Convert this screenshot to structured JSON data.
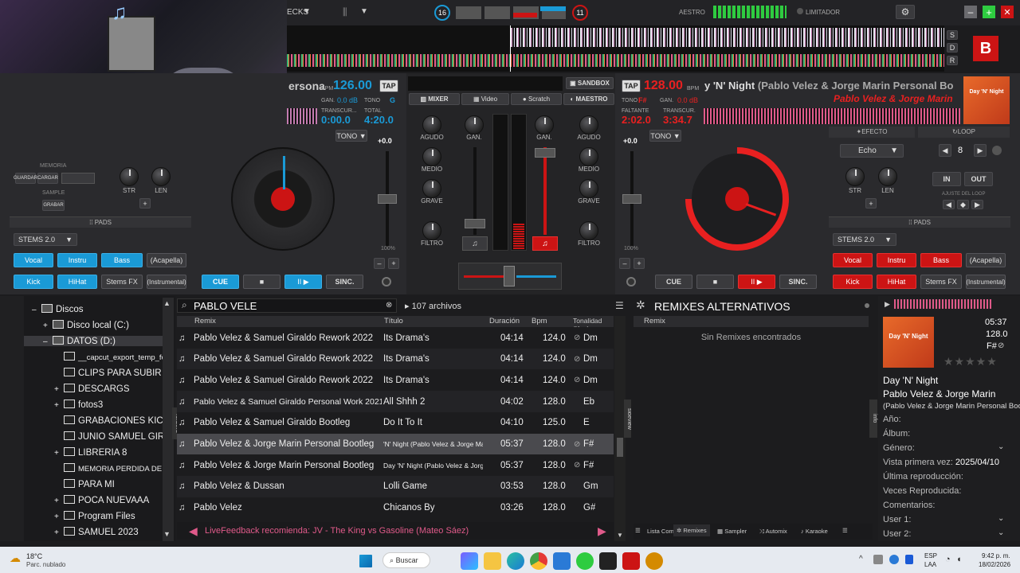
{
  "top": {
    "decks_label": "ECKS",
    "left_counter": "16",
    "right_counter": "11",
    "master_label": "AESTRO",
    "limiter_label": "LIMITADOR"
  },
  "deckA": {
    "title": "ersona",
    "bpm_label": "BPM",
    "bpm": "126.00",
    "tap": "TAP",
    "gain_label": "GAN.",
    "gain": "0.0 dB",
    "tono_label": "TONO",
    "key": "G",
    "elapsed_label": "TRANSCUR...",
    "elapsed": "0:00.0",
    "total_label": "TOTAL",
    "total": "4:20.0",
    "tono_btn": "TONO",
    "pitch": "+0.0",
    "pitch_pct": "100%",
    "memory": "MEMORIA",
    "save": "GUARDAR",
    "load": "CARGAR",
    "sample": "SAMPLE",
    "record": "GRABAR",
    "str": "STR",
    "len": "LEN",
    "pads": "PADS",
    "stems": "STEMS 2.0",
    "pad_labels": [
      "Vocal",
      "Instru",
      "Bass",
      "(Acapella)",
      "Kick",
      "HiHat",
      "Stems FX",
      "(Instrumental)"
    ],
    "cue": "CUE",
    "sync": "SINC."
  },
  "deckB": {
    "tap": "TAP",
    "bpm": "128.00",
    "bpm_label": "BPM",
    "title": "y 'N' Night",
    "title_rest": "(Pablo Velez & Jorge Marin Personal Bo",
    "artist": "Pablo Velez & Jorge Marin",
    "tono_label": "TONO",
    "key": "F#",
    "gain_label": "GAN.",
    "gain": "0.0 dB",
    "remain_label": "FALTANTE",
    "remain": "2:02.0",
    "elapsed_label": "TRANSCUR.",
    "elapsed": "3:34.7",
    "tono_btn": "TONO",
    "pitch": "+0.0",
    "pitch_pct": "100%",
    "effect": "EFECTO",
    "effect_value": "Echo",
    "loop": "LOOP",
    "loop_value": "8",
    "str": "STR",
    "len": "LEN",
    "in": "IN",
    "out": "OUT",
    "loop_adjust": "AJUSTE DEL LOOP",
    "pads": "PADS",
    "stems": "STEMS 2.0",
    "pad_labels": [
      "Vocal",
      "Instru",
      "Bass",
      "(Acapella)",
      "Kick",
      "HiHat",
      "Stems FX",
      "(Instrumental)"
    ],
    "cue": "CUE",
    "sync": "SINC.",
    "cover_title": "Day 'N' Night"
  },
  "mixer": {
    "sandbox": "SANDBOX",
    "tabs": [
      "MIXER",
      "Video",
      "Scratch",
      "MAESTRO"
    ],
    "agudo": "AGUDO",
    "medio": "MEDIO",
    "grave": "GRAVE",
    "filtro": "FILTRO",
    "gain": "GAN."
  },
  "browser": {
    "search": "PABLO VELE",
    "count": "107 archivos",
    "headers": [
      "Remix",
      "Título",
      "Duración",
      "Bpm",
      "Tonalidad (Key)"
    ],
    "rows": [
      {
        "remix": "Pablo Velez & Samuel Giraldo Rework 2022",
        "title": "Its Drama's",
        "dur": "04:14",
        "bpm": "124.0",
        "key": "Dm"
      },
      {
        "remix": "Pablo Velez & Samuel Giraldo Rework 2022",
        "title": "Its Drama's",
        "dur": "04:14",
        "bpm": "124.0",
        "key": "Dm"
      },
      {
        "remix": "Pablo Velez & Samuel Giraldo Rework 2022",
        "title": "Its Drama's",
        "dur": "04:14",
        "bpm": "124.0",
        "key": "Dm"
      },
      {
        "remix": "Pablo Velez & Samuel Giraldo Personal Work 2021",
        "title": "All Shhh 2",
        "dur": "04:02",
        "bpm": "128.0",
        "key": "Eb"
      },
      {
        "remix": "Pablo Velez & Samuel Giraldo Bootleg",
        "title": "Do It To It",
        "dur": "04:10",
        "bpm": "125.0",
        "key": "E"
      },
      {
        "remix": "Pablo Velez & Jorge Marin Personal Bootleg",
        "title": "'N' Night (Pablo Velez & Jorge Marin",
        "dur": "05:37",
        "bpm": "128.0",
        "key": "F#"
      },
      {
        "remix": "Pablo Velez & Jorge Marin Personal Bootleg",
        "title": "Day 'N' Night (Pablo Velez & Jorg...",
        "dur": "05:37",
        "bpm": "128.0",
        "key": "F#"
      },
      {
        "remix": "Pablo Velez & Dussan",
        "title": "Lolli Game",
        "dur": "03:53",
        "bpm": "128.0",
        "key": "Gm"
      },
      {
        "remix": "Pablo Velez",
        "title": "Chicanos By",
        "dur": "03:26",
        "bpm": "128.0",
        "key": "G#"
      }
    ],
    "feedback": "LiveFeedback recomienda: JV - The King vs Gasoline (Mateo Sáez)"
  },
  "tree": {
    "items": [
      "Discos",
      "Disco local (C:)",
      "DATOS (D:)",
      "__capcut_export_temp_folde",
      "CLIPS PARA SUBIR",
      "DESCARGS",
      "fotos3",
      "GRABACIONES KICK",
      "JUNIO SAMUEL GIRALDO",
      "LIBRERIA 8",
      "MEMORIA PERDIDA DE FIRI",
      "PARA MI",
      "POCA NUEVAAA",
      "Program Files",
      "SAMUEL 2023"
    ],
    "folders_tab": "folders",
    "sideview_tab": "sideview"
  },
  "remixes": {
    "title": "REMIXES ALTERNATIVOS",
    "header": "Remix",
    "empty": "Sin Remixes encontrados",
    "bottom": [
      "Lista Com",
      "Remixes",
      "Sampler",
      "Automix",
      "Karaoke"
    ]
  },
  "info": {
    "duration": "05:37",
    "bpm": "128.0",
    "key": "F#",
    "title": "Day 'N' Night",
    "artist": "Pablo Velez & Jorge Marin",
    "remix": "(Pablo Velez & Jorge Marin Personal Bootleg)",
    "year": "Año:",
    "album": "Álbum:",
    "genre": "Género:",
    "first_seen": "Vista primera vez:",
    "first_seen_val": "2025/04/10",
    "last_play": "Última reproducción:",
    "plays": "Veces Reproducida:",
    "comments": "Comentarios:",
    "user1": "User 1:",
    "user2": "User 2:",
    "tab": "info"
  },
  "taskbar": {
    "temp": "18°C",
    "weather": "Parc. nublado",
    "search": "Buscar",
    "lang": "ESP",
    "lang2": "LAA",
    "time": "9:42 p. m.",
    "date": "18/02/2026"
  },
  "colors": {
    "accent_blue": "#1a9ad6",
    "accent_red": "#cc1414",
    "bg": "#1c1c1e"
  }
}
